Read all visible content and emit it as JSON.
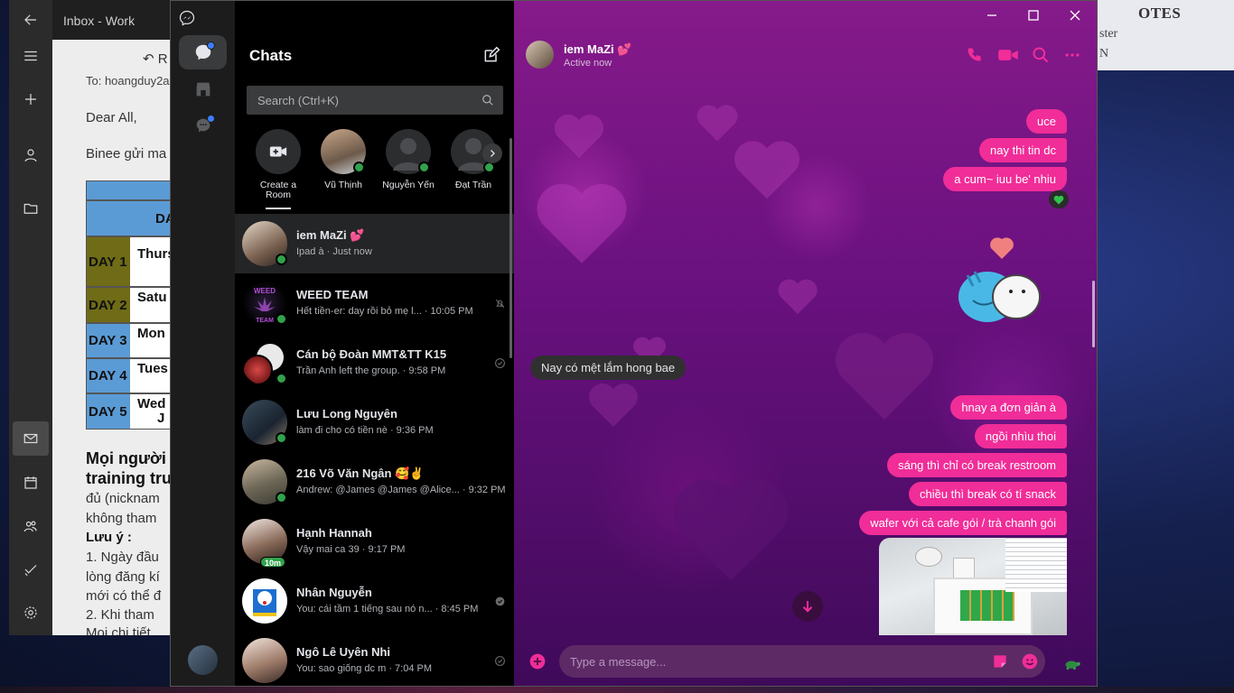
{
  "mail": {
    "title": "Inbox - Work",
    "reply_label": "R",
    "to_line": "To: hoangduy2a",
    "greeting": "Dear All,",
    "intro": "Binee gửi ma",
    "table_header": "DA",
    "days": [
      {
        "day": "DAY 1",
        "val": "Thurs",
        "color": "#6f6b16"
      },
      {
        "day": "DAY 2",
        "val": "Satu",
        "color": "#6f6b16"
      },
      {
        "day": "DAY 3",
        "val": "Mon",
        "color": "#5b9bd5"
      },
      {
        "day": "DAY 4",
        "val": "Tues",
        "color": "#5b9bd5"
      },
      {
        "day": "DAY 5",
        "val": "Wed",
        "color": "#5b9bd5"
      }
    ],
    "day5_extra": "J",
    "body_lines": [
      "Mọi người",
      "training tru",
      "đủ (nicknam",
      "không tham",
      "Lưu ý :",
      "1. Ngày đầu",
      "lòng đăng kí",
      "mới có thể đ",
      "2. Khi tham",
      "Mọi chi tiết"
    ]
  },
  "deco_right": {
    "line1": "OTES",
    "line2": "ster",
    "line3": "N"
  },
  "messenger": {
    "accent": "#f02d98",
    "list": {
      "title": "Chats",
      "search_placeholder": "Search (Ctrl+K)",
      "stories": [
        {
          "label": "Create a Room"
        },
        {
          "label": "Vũ Thịnh"
        },
        {
          "label": "Nguyễn Yến"
        },
        {
          "label": "Đạt Trần"
        }
      ],
      "chats": [
        {
          "name": "iem MaZi 💕",
          "preview": "Ipad à · Just now"
        },
        {
          "name": "WEED TEAM",
          "preview": "Hết tiền-er: day rồi bỏ mẹ l... · 10:05 PM"
        },
        {
          "name": "Cán bộ Đoàn MMT&TT K15",
          "preview": "Trần Anh left the group. · 9:58 PM"
        },
        {
          "name": "Lưu Long Nguyên",
          "preview": "làm đi cho có tiền nè · 9:36 PM"
        },
        {
          "name": "216 Võ Văn Ngân 🥰✌️",
          "preview": "Andrew: @James @James @Alice... · 9:32 PM"
        },
        {
          "name": "Hạnh Hannah",
          "preview": "Vậy mai ca 39 · 9:17 PM",
          "badge": "10m"
        },
        {
          "name": "Nhân Nguyễn",
          "preview": "You: cái tầm 1 tiếng sau nó n... · 8:45 PM"
        },
        {
          "name": "Ngô Lê Uyên Nhi",
          "preview": "You: sao giống dc m · 7:04 PM"
        }
      ]
    },
    "conversation": {
      "peer_name": "iem MaZi 💕",
      "peer_status": "Active now",
      "messages_out_1": [
        "uce",
        "nay thi tin dc",
        "a cum~ iuu be' nhiu"
      ],
      "message_in": "Nay có mệt lắm hong bae",
      "messages_out_2": [
        "hnay a đơn giản à",
        "ngồi nhìu thoi",
        "sáng thì chỉ có break restroom",
        "chiều thì break có tí snack",
        "wafer với cả cafe gói / trà chanh gói"
      ],
      "composer_placeholder": "Type a message..."
    }
  }
}
